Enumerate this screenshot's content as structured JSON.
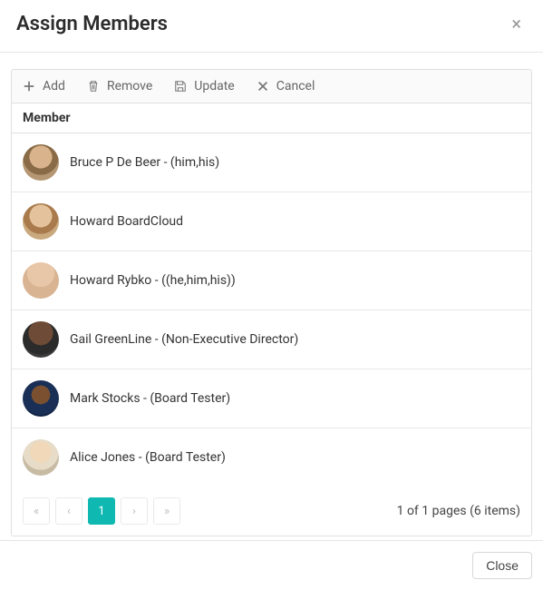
{
  "header": {
    "title": "Assign Members"
  },
  "toolbar": {
    "add": "Add",
    "remove": "Remove",
    "update": "Update",
    "cancel": "Cancel"
  },
  "grid": {
    "column_header": "Member",
    "rows": [
      {
        "name": "Bruce P De Beer - (him,his)"
      },
      {
        "name": "Howard BoardCloud"
      },
      {
        "name": "Howard Rybko - ((he,him,his))"
      },
      {
        "name": "Gail GreenLine - (Non-Executive Director)"
      },
      {
        "name": "Mark Stocks - (Board Tester)"
      },
      {
        "name": "Alice Jones - (Board Tester)"
      }
    ]
  },
  "pager": {
    "current": "1",
    "summary": "1 of 1 pages (6 items)"
  },
  "footer": {
    "close": "Close"
  }
}
